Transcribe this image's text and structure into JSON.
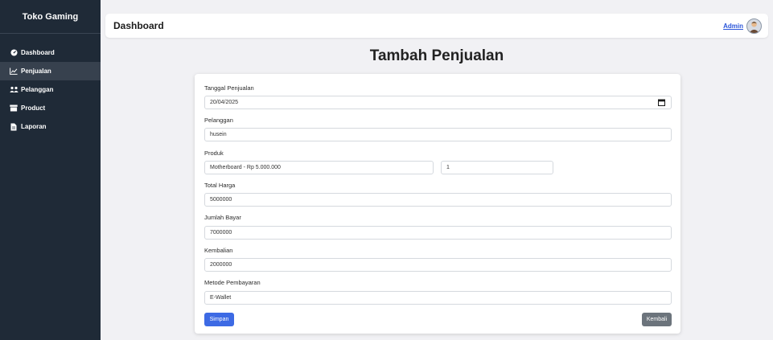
{
  "sidebar": {
    "brand": "Toko Gaming",
    "items": [
      {
        "label": "Dashboard",
        "icon": "gauge-icon"
      },
      {
        "label": "Penjualan",
        "icon": "chart-line-icon",
        "active": true
      },
      {
        "label": "Pelanggan",
        "icon": "users-icon"
      },
      {
        "label": "Product",
        "icon": "box-icon"
      },
      {
        "label": "Laporan",
        "icon": "file-icon"
      }
    ]
  },
  "topbar": {
    "title": "Dashboard",
    "user_label": "Admin"
  },
  "page": {
    "heading": "Tambah Penjualan"
  },
  "form": {
    "tanggal_label": "Tanggal Penjualan",
    "tanggal_value": "20/04/2025",
    "pelanggan_label": "Pelanggan",
    "pelanggan_value": "husein",
    "produk_label": "Produk",
    "produk_value": "Motherboard - Rp 5.000.000",
    "qty_value": "1",
    "total_label": "Total Harga",
    "total_value": "5000000",
    "bayar_label": "Jumlah Bayar",
    "bayar_value": "7000000",
    "kembalian_label": "Kembalian",
    "kembalian_value": "2000000",
    "metode_label": "Metode Pembayaran",
    "metode_value": "E-Wallet",
    "save_label": "Simpan",
    "back_label": "Kembali"
  },
  "colors": {
    "sidebar_bg": "#1f2a37",
    "primary": "#3d6ae4",
    "secondary": "#6c747c"
  }
}
